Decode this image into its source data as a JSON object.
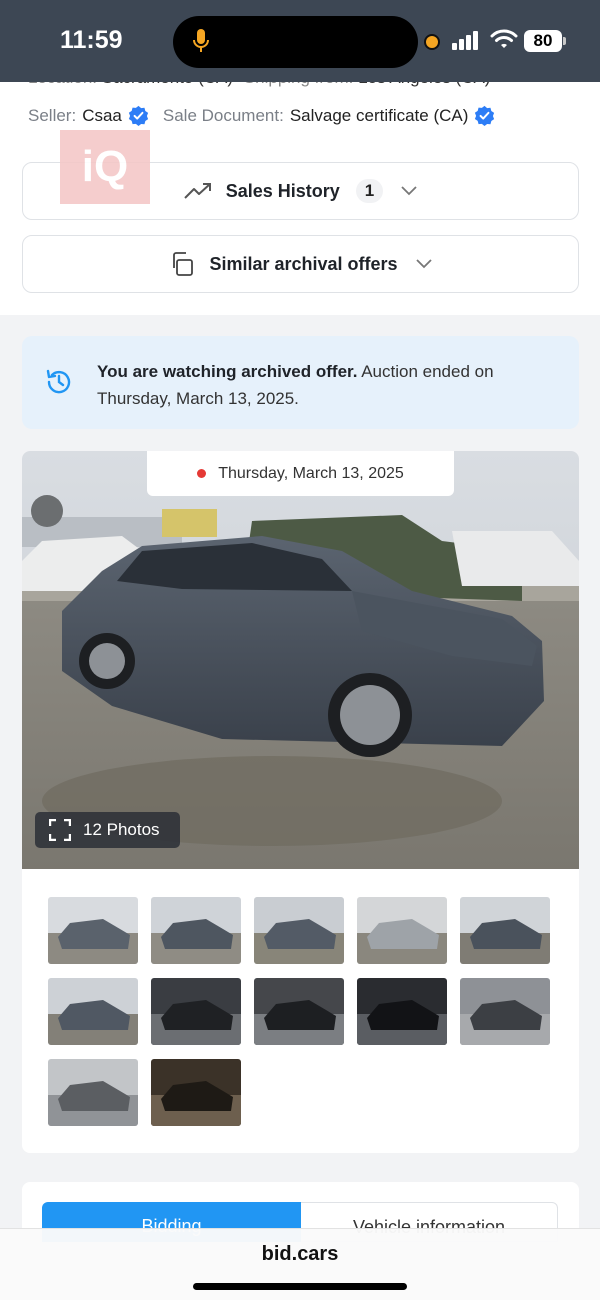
{
  "status": {
    "time": "11:59",
    "battery": "80"
  },
  "details": {
    "location_label": "Location:",
    "location_value": "Sacramento (CA)",
    "shipping_label": "Shipping from:",
    "shipping_value": "Los Angeles (CA)",
    "seller_label": "Seller:",
    "seller_value": "Csaa",
    "sale_doc_label": "Sale Document:",
    "sale_doc_value": "Salvage certificate (CA)"
  },
  "logo_text": "iQ",
  "sales_history": {
    "label": "Sales History",
    "count": "1"
  },
  "similar": {
    "label": "Similar archival offers"
  },
  "notice": {
    "bold": "You are watching archived offer.",
    "text": " Auction ended on Thursday, March 13, 2025."
  },
  "gallery": {
    "date": "Thursday, March 13, 2025",
    "photos_label": "12 Photos",
    "thumb_count": 12
  },
  "tabs": {
    "active": "Bidding",
    "inactive": "Vehicle information"
  },
  "browser": {
    "url": "bid.cars"
  },
  "colors": {
    "accent": "#2196f3",
    "status_bar": "#3d4754",
    "notice_bg": "#e6f1fb",
    "verified": "#2d7df6"
  }
}
